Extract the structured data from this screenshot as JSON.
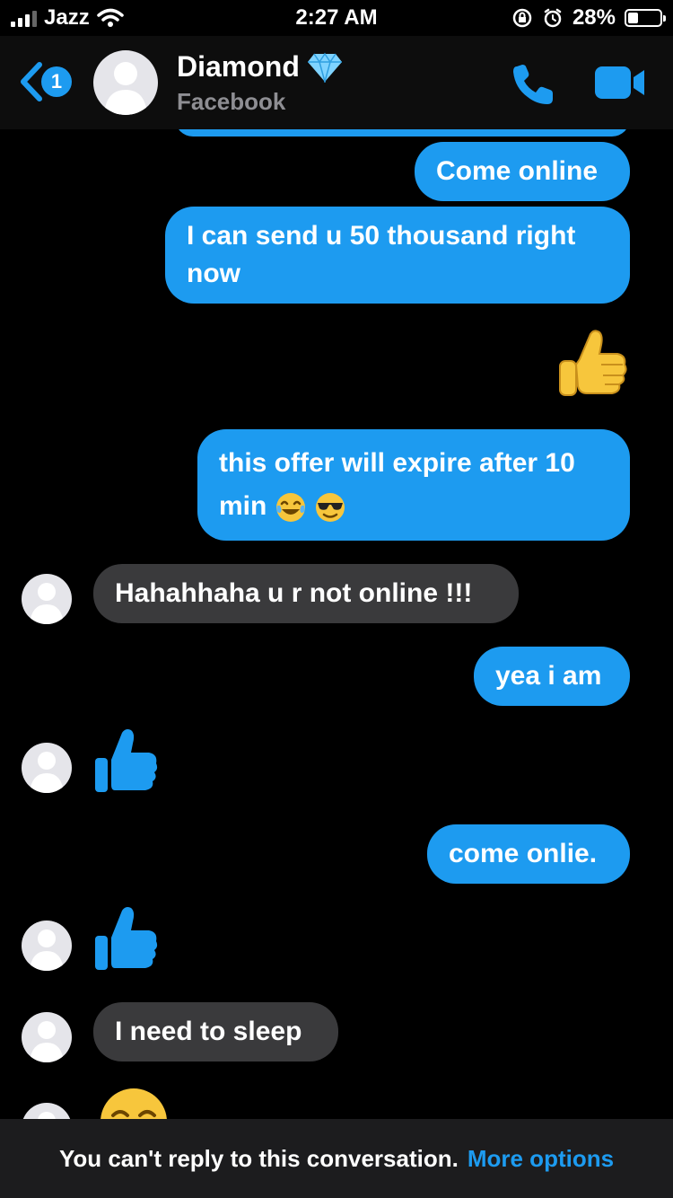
{
  "status_bar": {
    "carrier": "Jazz",
    "time": "2:27 AM",
    "battery": "28%",
    "battery_level": 0.28,
    "icons": [
      "signal-icon",
      "wifi-icon",
      "rotation-lock-icon",
      "alarm-icon",
      "battery-icon"
    ]
  },
  "header": {
    "back_badge": "1",
    "contact_name": "Diamond",
    "contact_subtitle": "Facebook",
    "icons": [
      "back-chevron-icon",
      "diamond-icon",
      "phone-icon",
      "video-camera-icon"
    ]
  },
  "messages": [
    {
      "from": "me",
      "type": "text",
      "text": "Come online"
    },
    {
      "from": "me",
      "type": "text",
      "text": "I can send u 50 thousand right now"
    },
    {
      "from": "me",
      "type": "emoji",
      "icon": "thumbs-up-emoji-icon"
    },
    {
      "from": "me",
      "type": "text",
      "text": "this offer will expire after 10 min",
      "trailing_emoji": [
        "tears-of-joy-emoji-icon",
        "sunglasses-emoji-icon"
      ]
    },
    {
      "from": "them",
      "type": "text",
      "text": "Hahahhaha u r not online !!!"
    },
    {
      "from": "me",
      "type": "text",
      "text": "yea i am"
    },
    {
      "from": "them",
      "type": "like",
      "icon": "like-thumb-icon"
    },
    {
      "from": "me",
      "type": "text",
      "text": "come onlie."
    },
    {
      "from": "them",
      "type": "like",
      "icon": "like-thumb-icon"
    },
    {
      "from": "them",
      "type": "text",
      "text": "I need to sleep"
    },
    {
      "from": "them",
      "type": "emoji",
      "icon": "partial-emoji-icon"
    }
  ],
  "footer": {
    "notice": "You can't reply to this conversation.",
    "more_options": "More options"
  },
  "colors": {
    "accent": "#1d9bf0",
    "background": "#000000",
    "received_bubble": "#3a3a3c",
    "header_bg": "#0d0d0d",
    "footer_bg": "#1c1c1e"
  }
}
